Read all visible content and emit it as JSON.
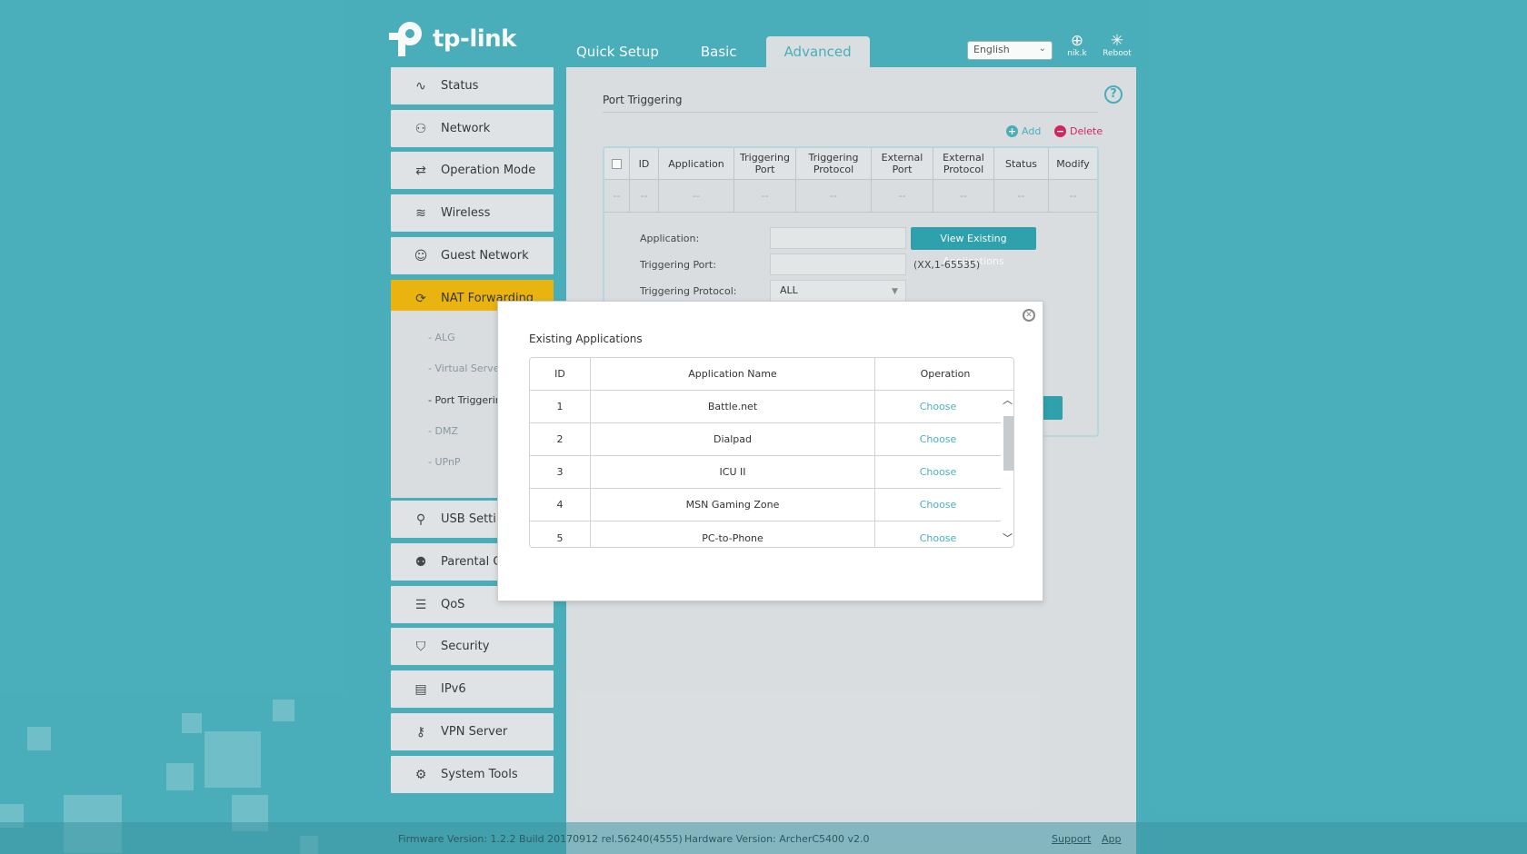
{
  "brand": {
    "name": "tp-link"
  },
  "topnav": {
    "tabs": [
      {
        "label": "Quick Setup",
        "active": false
      },
      {
        "label": "Basic",
        "active": false
      },
      {
        "label": "Advanced",
        "active": true
      }
    ]
  },
  "header": {
    "language": "English",
    "user_label": "nik.k",
    "reboot_label": "Reboot"
  },
  "sidebar": {
    "items": [
      {
        "label": "Status",
        "icon": "pulse-icon",
        "glyph": "∿"
      },
      {
        "label": "Network",
        "icon": "network-icon",
        "glyph": "⚇"
      },
      {
        "label": "Operation Mode",
        "icon": "swap-icon",
        "glyph": "⇄"
      },
      {
        "label": "Wireless",
        "icon": "wifi-icon",
        "glyph": "≋"
      },
      {
        "label": "Guest Network",
        "icon": "guest-icon",
        "glyph": "☺"
      },
      {
        "label": "NAT Forwarding",
        "icon": "nat-icon",
        "glyph": "⟳",
        "active": true
      },
      {
        "label": "USB Settings",
        "icon": "usb-icon",
        "glyph": "⚲"
      },
      {
        "label": "Parental Controls",
        "icon": "parental-icon",
        "glyph": "⚉"
      },
      {
        "label": "QoS",
        "icon": "qos-icon",
        "glyph": "☰"
      },
      {
        "label": "Security",
        "icon": "shield-icon",
        "glyph": "⛉"
      },
      {
        "label": "IPv6",
        "icon": "ipv6-icon",
        "glyph": "▤"
      },
      {
        "label": "VPN Server",
        "icon": "key-icon",
        "glyph": "⚷"
      },
      {
        "label": "System Tools",
        "icon": "gear-icon",
        "glyph": "⚙"
      }
    ],
    "submenu": [
      "ALG",
      "Virtual Servers",
      "Port Triggering",
      "DMZ",
      "UPnP"
    ]
  },
  "page": {
    "title": "Port Triggering",
    "add_label": "Add",
    "delete_label": "Delete",
    "columns": [
      "ID",
      "Application",
      "Triggering Port",
      "Triggering Protocol",
      "External Port",
      "External Protocol",
      "Status",
      "Modify"
    ],
    "empty_cell": "--",
    "form": {
      "application_label": "Application:",
      "triggering_port_label": "Triggering Port:",
      "triggering_protocol_label": "Triggering Protocol:",
      "protocol_value": "ALL",
      "view_button": "View Existing Applications",
      "port_hint": "(XX,1-65535)"
    }
  },
  "modal": {
    "title": "Existing Applications",
    "columns": [
      "ID",
      "Application Name",
      "Operation"
    ],
    "rows": [
      {
        "id": "1",
        "name": "Battle.net",
        "op": "Choose"
      },
      {
        "id": "2",
        "name": "Dialpad",
        "op": "Choose"
      },
      {
        "id": "3",
        "name": "ICU II",
        "op": "Choose"
      },
      {
        "id": "4",
        "name": "MSN Gaming Zone",
        "op": "Choose"
      },
      {
        "id": "5",
        "name": "PC-to-Phone",
        "op": "Choose"
      }
    ]
  },
  "footer": {
    "firmware": "Firmware Version: 1.2.2 Build 20170912 rel.56240(4555)",
    "hardware": "Hardware Version: ArcherC5400 v2.0",
    "support": "Support",
    "app": "App"
  },
  "colors": {
    "accent": "#48b0bd",
    "active_nav": "#f0b70a",
    "delete": "#d6215b"
  }
}
